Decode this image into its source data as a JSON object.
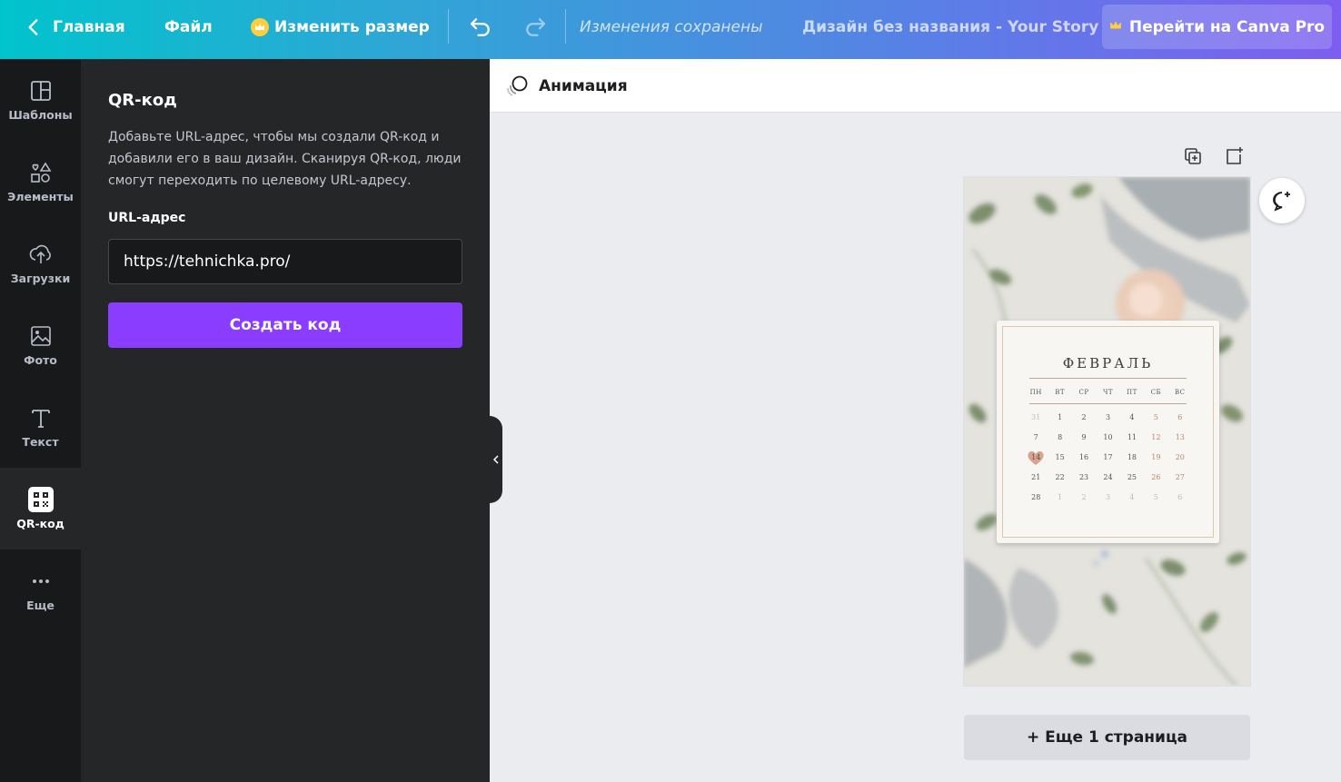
{
  "topbar": {
    "home_label": "Главная",
    "file_label": "Файл",
    "resize_label": "Изменить размер",
    "saved_status": "Изменения сохранены",
    "design_title": "Дизайн без названия - Your Story",
    "pro_button": "Перейти на Canva Pro"
  },
  "rail": {
    "items": [
      {
        "label": "Шаблоны",
        "icon": "templates-icon"
      },
      {
        "label": "Элементы",
        "icon": "elements-icon"
      },
      {
        "label": "Загрузки",
        "icon": "upload-icon"
      },
      {
        "label": "Фото",
        "icon": "photo-icon"
      },
      {
        "label": "Текст",
        "icon": "text-icon"
      },
      {
        "label": "QR-код",
        "icon": "qr-code-icon",
        "active": true
      },
      {
        "label": "Еще",
        "icon": "more-icon"
      }
    ]
  },
  "panel": {
    "title": "QR-код",
    "description": "Добавьте URL-адрес, чтобы мы создали QR-код и добавили его в ваш дизайн. Сканируя QR-код, люди смогут переходить по целевому URL-адресу.",
    "url_label": "URL-адрес",
    "url_value": "https://tehnichka.pro/",
    "create_button": "Создать код"
  },
  "animation_bar": {
    "label": "Анимация"
  },
  "calendar": {
    "month": "ФЕВРАЛЬ",
    "weekdays": [
      "ПН",
      "ВТ",
      "СР",
      "ЧТ",
      "ПТ",
      "СБ",
      "ВС"
    ],
    "weeks": [
      [
        "31",
        "1",
        "2",
        "3",
        "4",
        "5",
        "6"
      ],
      [
        "7",
        "8",
        "9",
        "10",
        "11",
        "12",
        "13"
      ],
      [
        "14",
        "15",
        "16",
        "17",
        "18",
        "19",
        "20"
      ],
      [
        "21",
        "22",
        "23",
        "24",
        "25",
        "26",
        "27"
      ],
      [
        "28",
        "1",
        "2",
        "3",
        "4",
        "5",
        "6"
      ]
    ],
    "highlighted_day": "14"
  },
  "more_pages_button": "+ Еще 1 страница",
  "colors": {
    "accent_purple": "#8b3dff",
    "gradient_start": "#00c4cc",
    "gradient_end": "#7d5ef0"
  }
}
